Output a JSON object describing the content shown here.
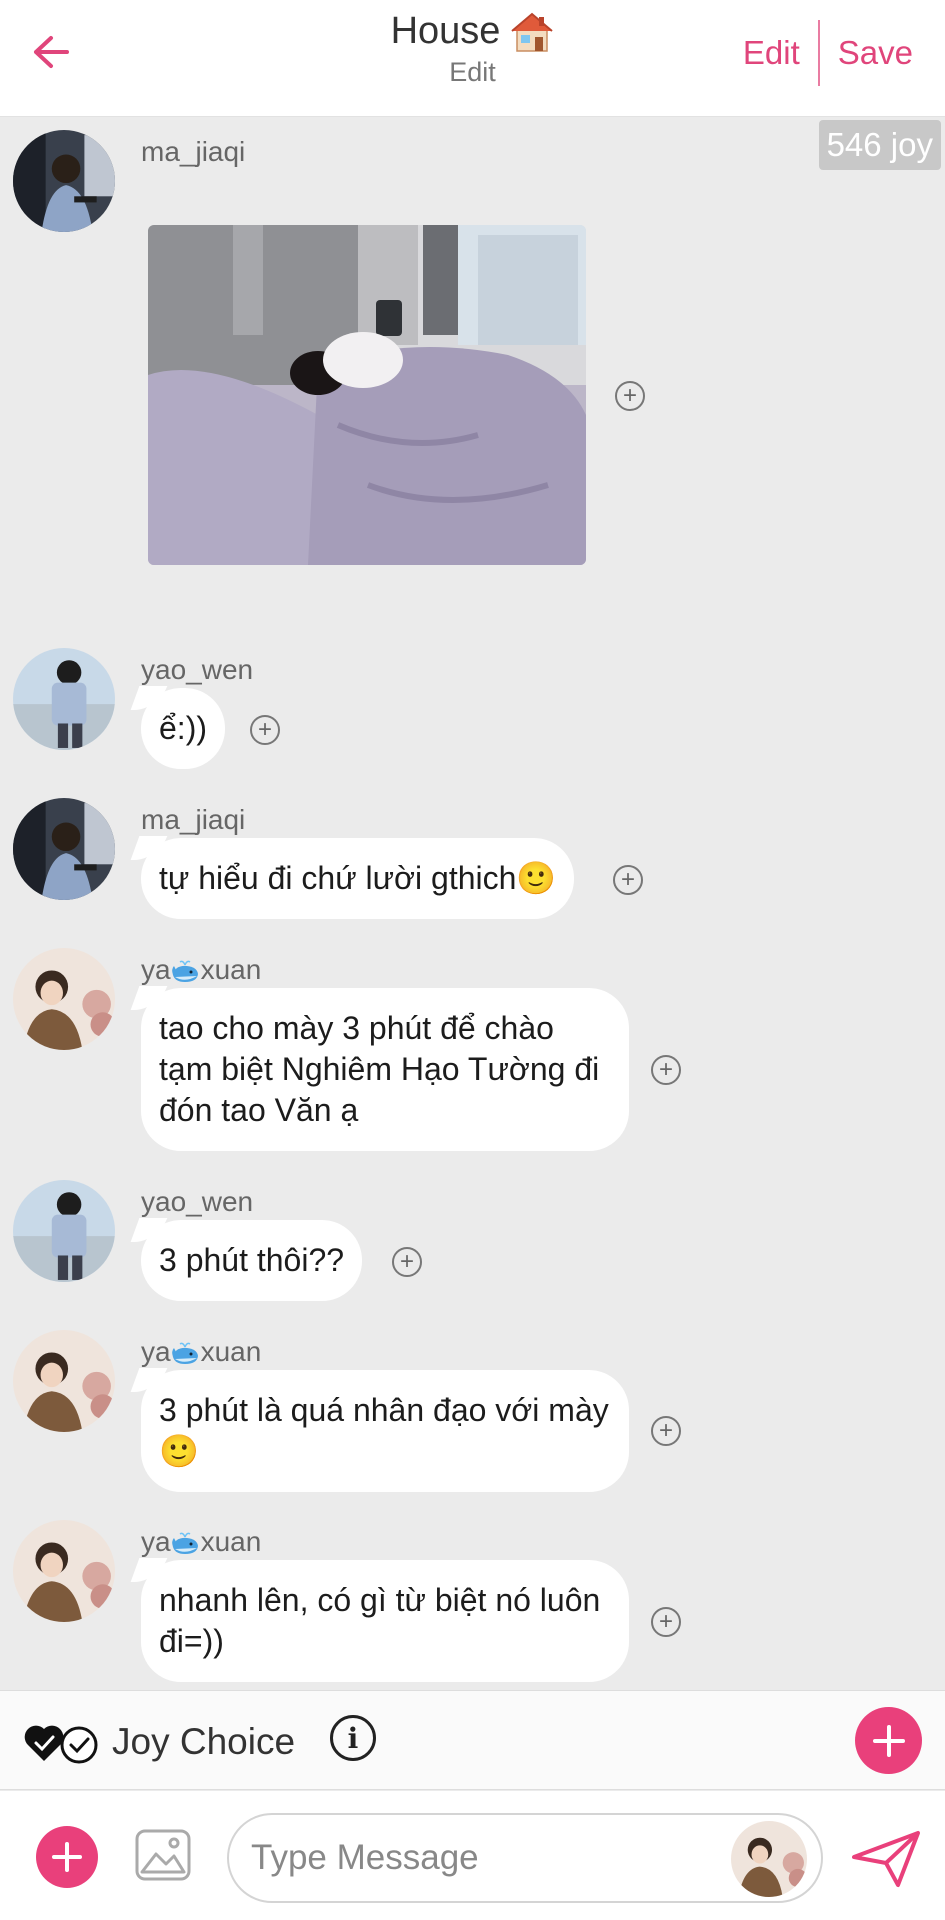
{
  "header": {
    "title": "House",
    "title_emoji": "house-icon",
    "subtitle": "Edit",
    "edit_label": "Edit",
    "save_label": "Save"
  },
  "joy_badge": "546 joy",
  "messages": [
    {
      "user": "ma_jiaqi",
      "type": "image",
      "image_alt": "photo of person sleeping under lilac blanket"
    },
    {
      "user": "yao_wen",
      "type": "text",
      "text": "ể:))"
    },
    {
      "user": "ma_jiaqi",
      "type": "text",
      "text": "tự hiểu đi chứ lười gthich🙂"
    },
    {
      "user_prefix": "ya",
      "user_suffix": "xuan",
      "user_emoji": "whale-icon",
      "type": "text",
      "text": "tao cho mày 3 phút để chào tạm biệt Nghiêm Hạo Tường đi đón tao Văn ạ"
    },
    {
      "user": "yao_wen",
      "type": "text",
      "text": "3 phút thôi??"
    },
    {
      "user_prefix": "ya",
      "user_suffix": "xuan",
      "user_emoji": "whale-icon",
      "type": "text",
      "text": "3 phút là quá nhân đạo với mày 🙂"
    },
    {
      "user_prefix": "ya",
      "user_suffix": "xuan",
      "user_emoji": "whale-icon",
      "type": "text",
      "text": "nhanh lên, có gì từ biệt nó luôn đi=))"
    }
  ],
  "joy_choice": {
    "label": "Joy Choice",
    "info_glyph": "i"
  },
  "composer": {
    "placeholder": "Type Message"
  },
  "colors": {
    "accent": "#e9407b",
    "background": "#ebebeb",
    "bubble": "#ffffff"
  }
}
